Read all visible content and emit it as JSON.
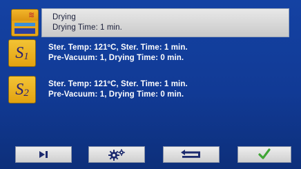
{
  "programs": [
    {
      "icon": "drying-icon",
      "line1": "Drying",
      "line2": "Drying Time: 1 min.",
      "selected": true
    },
    {
      "icon": "s1-icon",
      "icon_label": "S",
      "icon_sub": "1",
      "line1": "Ster. Temp: 121ºC, Ster. Time: 1 min.",
      "line2": "Pre-Vacuum: 1, Drying Time: 0 min."
    },
    {
      "icon": "s2-icon",
      "icon_label": "S",
      "icon_sub": "2",
      "line1": "Ster. Temp: 121ºC, Ster. Time: 1 min.",
      "line2": "Pre-Vacuum: 1, Drying Time: 0 min."
    }
  ],
  "toolbar": {
    "buttons": [
      {
        "icon": "skip-forward-icon"
      },
      {
        "icon": "gears-icon"
      },
      {
        "icon": "return-icon"
      },
      {
        "icon": "checkmark-icon"
      }
    ]
  },
  "colors": {
    "background": "#1442a3",
    "icon_gold": "#e6a51a",
    "check_green": "#3fa535",
    "icon_dark_blue": "#1c2a6e"
  }
}
